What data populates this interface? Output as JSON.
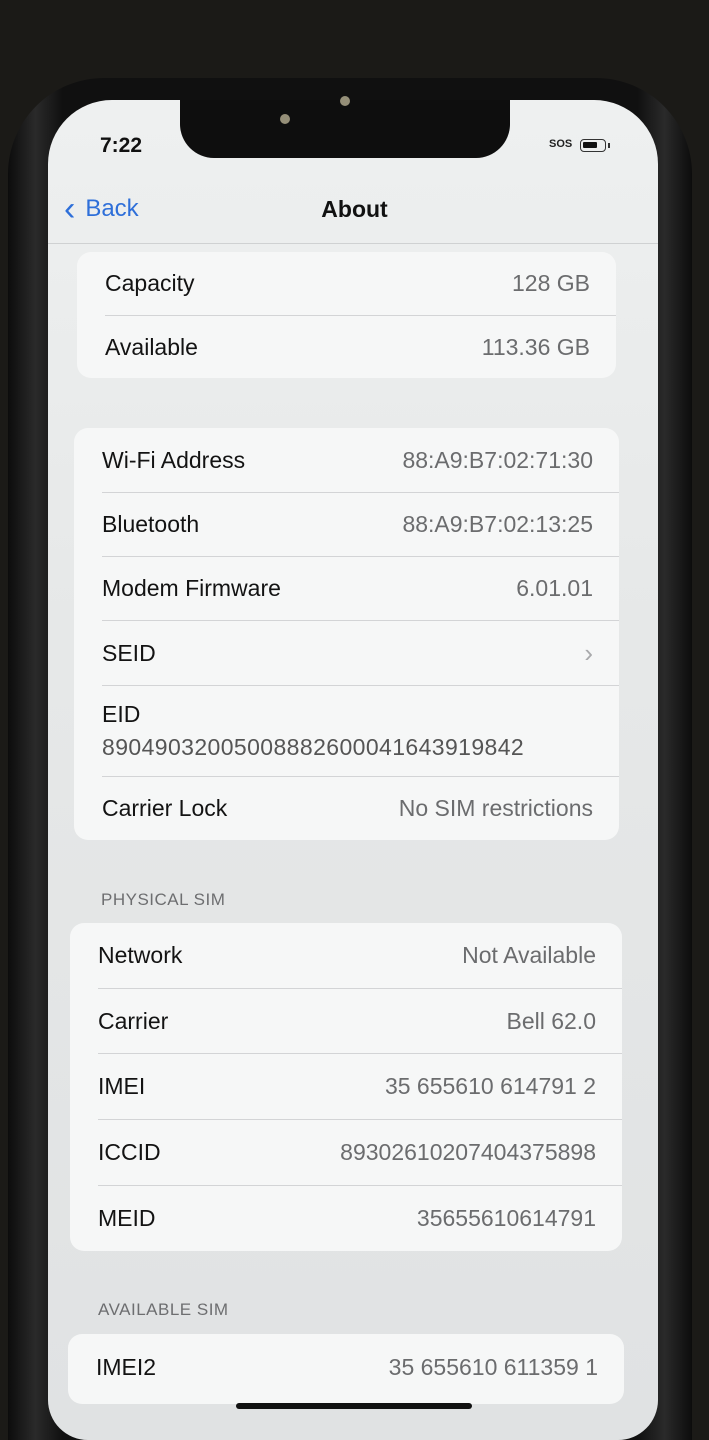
{
  "status_bar": {
    "time": "7:22",
    "sos": "SOS"
  },
  "nav": {
    "back_label": "Back",
    "title": "About"
  },
  "storage": {
    "rows": [
      {
        "label": "Capacity",
        "value": "128 GB"
      },
      {
        "label": "Available",
        "value": "113.36 GB"
      }
    ]
  },
  "network_info": {
    "rows": [
      {
        "label": "Wi-Fi Address",
        "value": "88:A9:B7:02:71:30"
      },
      {
        "label": "Bluetooth",
        "value": "88:A9:B7:02:13:25"
      },
      {
        "label": "Modem Firmware",
        "value": "6.01.01"
      },
      {
        "label": "SEID",
        "value": ""
      },
      {
        "label": "EID",
        "value": "89049032005008882600041643919842"
      },
      {
        "label": "Carrier Lock",
        "value": "No SIM restrictions"
      }
    ]
  },
  "physical_sim": {
    "header": "PHYSICAL SIM",
    "rows": [
      {
        "label": "Network",
        "value": "Not Available"
      },
      {
        "label": "Carrier",
        "value": "Bell 62.0"
      },
      {
        "label": "IMEI",
        "value": "35 655610 614791 2"
      },
      {
        "label": "ICCID",
        "value": "8930261020740437589­8"
      },
      {
        "label": "MEID",
        "value": "35655610614791"
      }
    ]
  },
  "available_sim": {
    "header": "AVAILABLE SIM",
    "rows": [
      {
        "label": "IMEI2",
        "value": "35 655610 611359 1"
      }
    ]
  }
}
